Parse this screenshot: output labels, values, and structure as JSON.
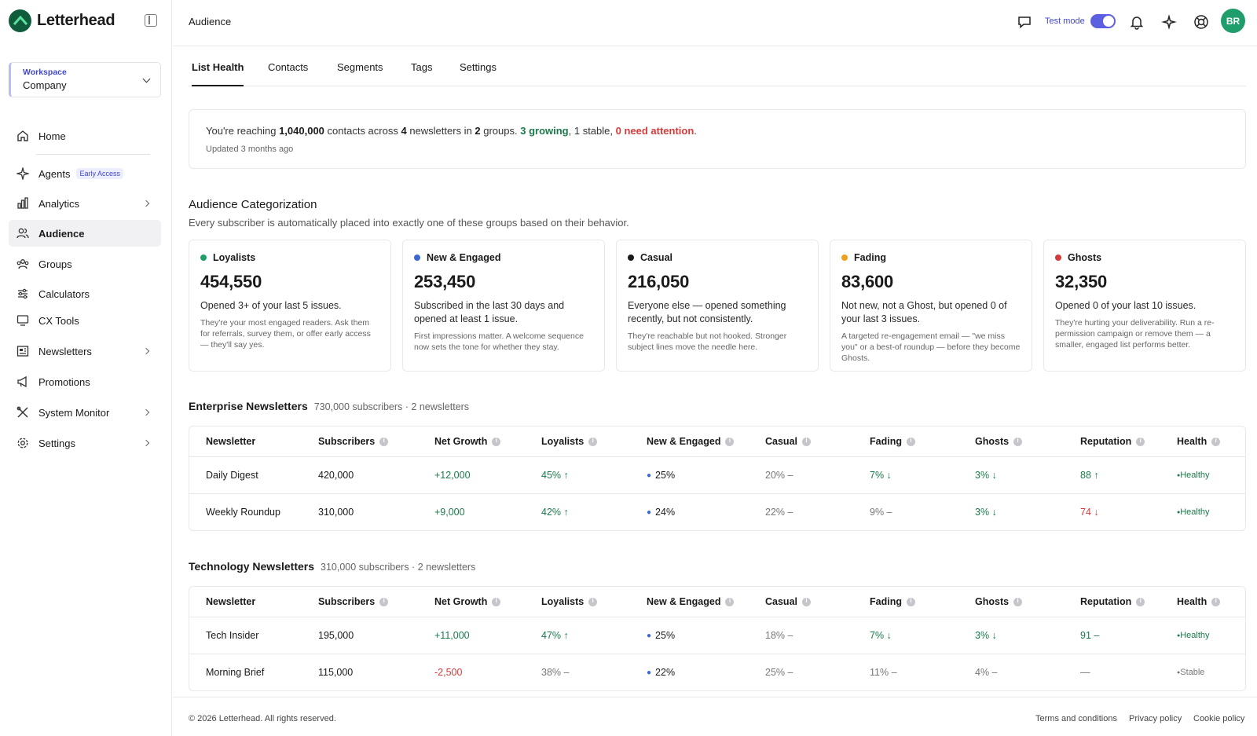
{
  "brand": {
    "name": "Letterhead",
    "color": "#0f5c3b"
  },
  "workspace": {
    "label": "Workspace",
    "name": "Company"
  },
  "nav": [
    {
      "label": "Home",
      "icon": "home-icon"
    },
    {
      "label": "Agents",
      "icon": "sparkle-icon",
      "badge": "Early Access"
    },
    {
      "label": "Analytics",
      "icon": "bar-chart-icon"
    },
    {
      "label": "Audience",
      "icon": "users-icon"
    },
    {
      "label": "Groups",
      "icon": "groups-icon"
    },
    {
      "label": "Calculators",
      "icon": "sliders-icon"
    },
    {
      "label": "CX Tools",
      "icon": "monitor-icon"
    },
    {
      "label": "Newsletters",
      "icon": "newspaper-icon"
    },
    {
      "label": "Promotions",
      "icon": "megaphone-icon"
    },
    {
      "label": "System Monitor",
      "icon": "tools-icon"
    },
    {
      "label": "Settings",
      "icon": "gear-icon"
    }
  ],
  "header": {
    "title": "Audience",
    "test_mode_label": "Test mode",
    "test_mode_on": true,
    "avatar_initials": "BR"
  },
  "tabs": [
    "List Health",
    "Contacts",
    "Segments",
    "Tags",
    "Settings"
  ],
  "summary": {
    "prefix": "You're reaching ",
    "contacts": "1,040,000",
    "mid1": " contacts across ",
    "newsletters": "4",
    "mid2": " newsletters in ",
    "groups": "2",
    "mid3": " groups. ",
    "growing": "3 growing",
    "stable": ", 1 stable, ",
    "attention": "0 need attention",
    "end": ".",
    "updated": "Updated 3 months ago"
  },
  "categorization": {
    "title": "Audience Categorization",
    "subtitle": "Every subscriber is automatically placed into exactly one of these groups based on their behavior.",
    "cards": [
      {
        "name": "Loyalists",
        "color": "#1f9d6b",
        "value": "454,550",
        "desc": "Opened 3+ of your last 5 issues.",
        "note": "They're your most engaged readers. Ask them for referrals, survey them, or offer early access — they'll say yes."
      },
      {
        "name": "New & Engaged",
        "color": "#3b66d4",
        "value": "253,450",
        "desc": "Subscribed in the last 30 days and opened at least 1 issue.",
        "note": "First impressions matter. A welcome sequence now sets the tone for whether they stay."
      },
      {
        "name": "Casual",
        "color": "#1a1a1a",
        "value": "216,050",
        "desc": "Everyone else — opened something recently, but not consistently.",
        "note": "They're reachable but not hooked. Stronger subject lines move the needle here."
      },
      {
        "name": "Fading",
        "color": "#f0a020",
        "value": "83,600",
        "desc": "Not new, not a Ghost, but opened 0 of your last 3 issues.",
        "note": "A targeted re-engagement email — \"we miss you\" or a best-of roundup — before they become Ghosts."
      },
      {
        "name": "Ghosts",
        "color": "#d43b3b",
        "value": "32,350",
        "desc": "Opened 0 of your last 10 issues.",
        "note": "They're hurting your deliverability. Run a re-permission campaign or remove them — a smaller, engaged list performs better."
      }
    ]
  },
  "columns": [
    "Newsletter",
    "Subscribers",
    "Net Growth",
    "Loyalists",
    "New & Engaged",
    "Casual",
    "Fading",
    "Ghosts",
    "Reputation",
    "Health"
  ],
  "groups": [
    {
      "title": "Enterprise Newsletters",
      "meta": "730,000 subscribers · 2 newsletters",
      "rows": [
        {
          "name": "Daily Digest",
          "subscribers": "420,000",
          "growth": "+12,000",
          "growth_dir": "pos",
          "loyalists": "45% ↑",
          "loy_dir": "pos",
          "new_engaged": "25%",
          "casual": "20% –",
          "fading": "7% ↓",
          "fad_dir": "pos",
          "ghosts": "3% ↓",
          "gho_dir": "pos",
          "reputation": "88 ↑",
          "rep_dir": "pos",
          "health": "Healthy",
          "health_kind": "healthy"
        },
        {
          "name": "Weekly Roundup",
          "subscribers": "310,000",
          "growth": "+9,000",
          "growth_dir": "pos",
          "loyalists": "42% ↑",
          "loy_dir": "pos",
          "new_engaged": "24%",
          "casual": "22% –",
          "fading": "9% –",
          "fad_dir": "muted",
          "ghosts": "3% ↓",
          "gho_dir": "pos",
          "reputation": "74 ↓",
          "rep_dir": "neg",
          "health": "Healthy",
          "health_kind": "healthy"
        }
      ]
    },
    {
      "title": "Technology Newsletters",
      "meta": "310,000 subscribers · 2 newsletters",
      "rows": [
        {
          "name": "Tech Insider",
          "subscribers": "195,000",
          "growth": "+11,000",
          "growth_dir": "pos",
          "loyalists": "47% ↑",
          "loy_dir": "pos",
          "new_engaged": "25%",
          "casual": "18% –",
          "fading": "7% ↓",
          "fad_dir": "pos",
          "ghosts": "3% ↓",
          "gho_dir": "pos",
          "reputation": "91 –",
          "rep_dir": "pos",
          "health": "Healthy",
          "health_kind": "healthy"
        },
        {
          "name": "Morning Brief",
          "subscribers": "115,000",
          "growth": "-2,500",
          "growth_dir": "neg",
          "loyalists": "38% –",
          "loy_dir": "muted",
          "new_engaged": "22%",
          "casual": "25% –",
          "fading": "11% –",
          "fad_dir": "muted",
          "ghosts": "4% –",
          "gho_dir": "muted",
          "reputation": "—",
          "rep_dir": "muted",
          "health": "Stable",
          "health_kind": "stable"
        }
      ]
    }
  ],
  "footer": {
    "copyright": "© 2026 Letterhead. All rights reserved.",
    "links": [
      "Terms and conditions",
      "Privacy policy",
      "Cookie policy"
    ]
  }
}
